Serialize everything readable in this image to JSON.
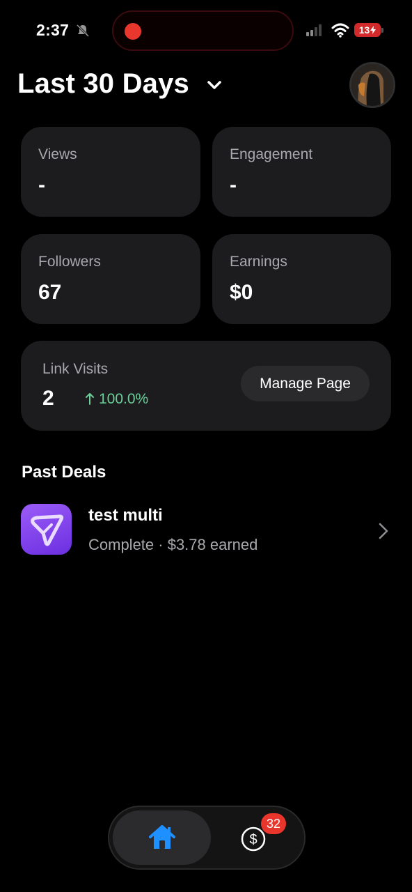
{
  "status_bar": {
    "time": "2:37",
    "battery": "13"
  },
  "header": {
    "title": "Last 30 Days"
  },
  "stats": {
    "views": {
      "label": "Views",
      "value": "-"
    },
    "engagement": {
      "label": "Engagement",
      "value": "-"
    },
    "followers": {
      "label": "Followers",
      "value": "67"
    },
    "earnings": {
      "label": "Earnings",
      "value": "$0"
    }
  },
  "link_visits": {
    "label": "Link Visits",
    "value": "2",
    "change": "100.0%",
    "button_label": "Manage Page"
  },
  "past_deals": {
    "title": "Past Deals",
    "items": [
      {
        "title": "test multi",
        "subtitle": "Complete · $3.78 earned"
      }
    ]
  },
  "tabbar": {
    "earnings_badge": "32"
  },
  "colors": {
    "background": "#000000",
    "card": "#1c1c1e",
    "accent_blue": "#1e90ff",
    "positive_green": "#6ccf9a",
    "badge_red": "#e8362d",
    "deal_icon_purple": "#8a4cf0"
  },
  "icons": [
    "bell-icon",
    "signal-icon",
    "wifi-icon",
    "chevron-down-icon",
    "arrow-up-icon",
    "chevron-right-icon",
    "home-icon",
    "dollar-icon"
  ]
}
